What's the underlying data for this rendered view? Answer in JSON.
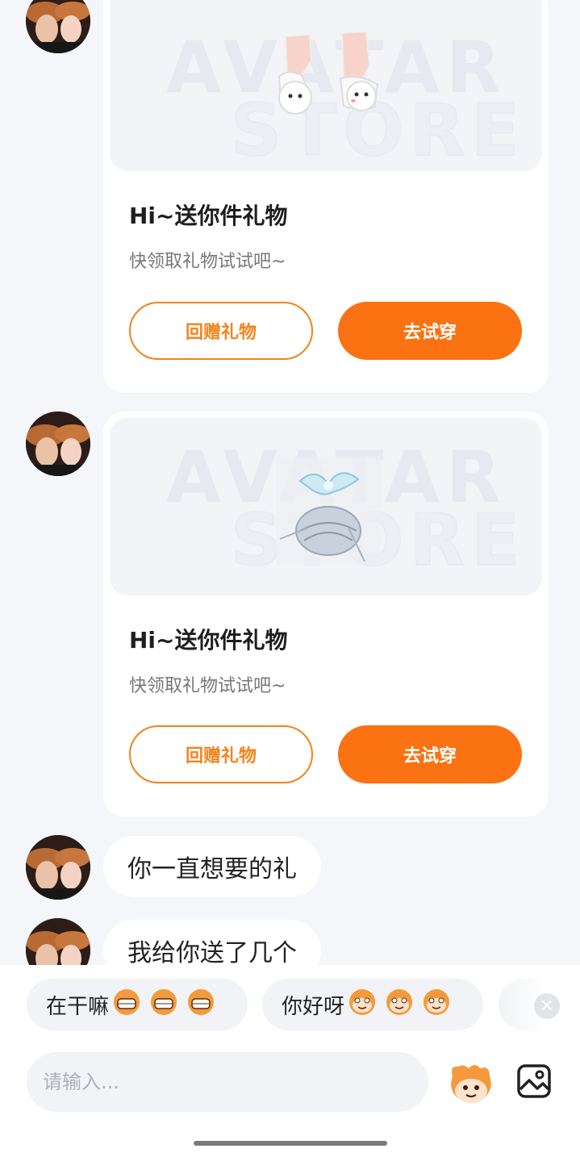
{
  "messages": {
    "gift_card_1": {
      "watermark_line1": "AVATAR",
      "watermark_line2": "STORE",
      "title": "Hi~送你件礼物",
      "subtitle": "快领取礼物试试吧~",
      "return_button": "回赠礼物",
      "try_button": "去试穿"
    },
    "gift_card_2": {
      "watermark_line1": "AVATAR",
      "watermark_line2": "STORE",
      "title": "Hi~送你件礼物",
      "subtitle": "快领取礼物试试吧~",
      "return_button": "回赠礼物",
      "try_button": "去试穿"
    },
    "text_1": "你一直想要的礼",
    "text_2": "我给你送了几个"
  },
  "quick_replies": [
    {
      "label": "在干嘛",
      "emoji": "grin-emoji"
    },
    {
      "label": "你好呀",
      "emoji": "smile-emoji"
    }
  ],
  "input": {
    "placeholder": "请输入..."
  },
  "icons": {
    "emoji": "mascot-emoji-icon",
    "image": "image-icon",
    "close": "close-icon"
  },
  "colors": {
    "accent": "#fa7212",
    "accent_outline": "#f3841c"
  }
}
